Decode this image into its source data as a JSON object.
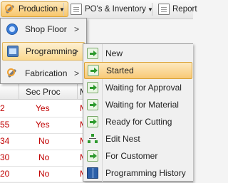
{
  "toolbar": {
    "production_label": "Production",
    "pos_label": "PO's & Inventory",
    "reports_label": "Report"
  },
  "grid": {
    "headers": {
      "sec_proc": "Sec Proc",
      "next": "M"
    },
    "rows": [
      {
        "c1": "2",
        "c2": "Yes",
        "c3": "M"
      },
      {
        "c1": "55",
        "c2": "Yes",
        "c3": "M"
      },
      {
        "c1": "34",
        "c2": "No",
        "c3": "M"
      },
      {
        "c1": "30",
        "c2": "No",
        "c3": "M"
      },
      {
        "c1": "20",
        "c2": "No",
        "c3": "M"
      }
    ]
  },
  "menu": {
    "items": [
      {
        "label": "Shop Floor",
        "icon": "gauge-icon"
      },
      {
        "label": "Programming",
        "icon": "board-icon"
      },
      {
        "label": "Fabrication",
        "icon": "wrench-icon"
      }
    ]
  },
  "submenu": {
    "items": [
      {
        "label": "New",
        "icon": "arrow-icon"
      },
      {
        "label": "Started",
        "icon": "arrow-icon"
      },
      {
        "label": "Waiting for Approval",
        "icon": "arrow-icon"
      },
      {
        "label": "Waiting for Material",
        "icon": "arrow-icon"
      },
      {
        "label": "Ready for Cutting",
        "icon": "arrow-icon"
      },
      {
        "label": "Edit Nest",
        "icon": "nest-icon"
      },
      {
        "label": "For Customer",
        "icon": "arrow-icon"
      },
      {
        "label": "Programming History",
        "icon": "book-icon"
      }
    ]
  },
  "colors": {
    "accent": "#f7c66c",
    "value_red": "#c00000"
  }
}
